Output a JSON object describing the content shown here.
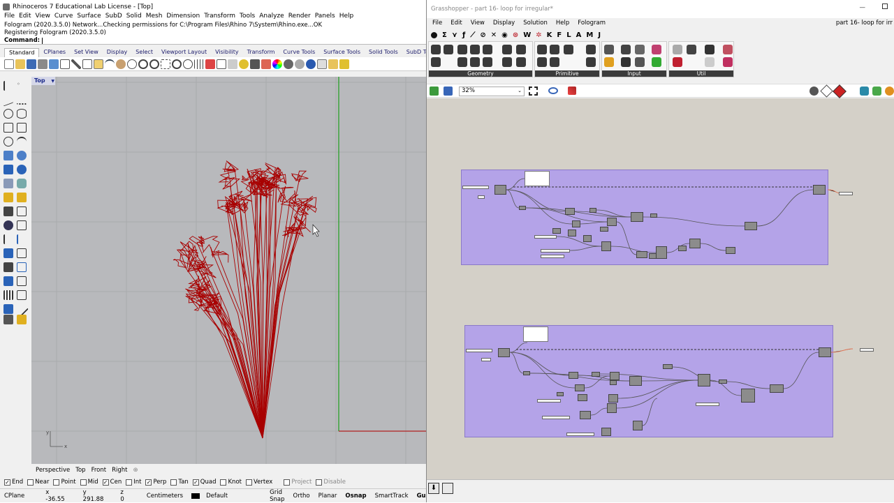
{
  "rhino": {
    "title": "Rhinoceros 7 Educational Lab License - [Top]",
    "menu": [
      "File",
      "Edit",
      "View",
      "Curve",
      "Surface",
      "SubD",
      "Solid",
      "Mesh",
      "Dimension",
      "Transform",
      "Tools",
      "Analyze",
      "Render",
      "Panels",
      "Help"
    ],
    "command_history": [
      "Fologram (2020.3.5.0) Network...Checking permissions for C:\\Program Files\\Rhino 7\\System\\Rhino.exe...OK",
      "Registering Fologram (2020.3.5.0)"
    ],
    "command_label": "Command:",
    "toolbar_tabs": [
      "Standard",
      "CPlanes",
      "Set View",
      "Display",
      "Select",
      "Viewport Layout",
      "Visibility",
      "Transform",
      "Curve Tools",
      "Surface Tools",
      "Solid Tools",
      "SubD Tools"
    ],
    "active_tab": "Standard",
    "viewport_label": "Top",
    "axis_x": "x",
    "axis_y": "y",
    "viewport_tabs": [
      "Perspective",
      "Top",
      "Front",
      "Right"
    ],
    "osnaps": [
      {
        "label": "End",
        "checked": true
      },
      {
        "label": "Near",
        "checked": false
      },
      {
        "label": "Point",
        "checked": false
      },
      {
        "label": "Mid",
        "checked": false
      },
      {
        "label": "Cen",
        "checked": true
      },
      {
        "label": "Int",
        "checked": false
      },
      {
        "label": "Perp",
        "checked": true
      },
      {
        "label": "Tan",
        "checked": false
      },
      {
        "label": "Quad",
        "checked": true
      },
      {
        "label": "Knot",
        "checked": false
      },
      {
        "label": "Vertex",
        "checked": false
      },
      {
        "label": "Project",
        "checked": false
      },
      {
        "label": "Disable",
        "checked": false
      }
    ],
    "status": {
      "cplane": "CPlane",
      "x": "x -36.55",
      "y": "y 291.88",
      "z": "z 0",
      "units": "Centimeters",
      "layer": "Default",
      "grid_snap": "Grid Snap",
      "ortho": "Ortho",
      "planar": "Planar",
      "osnap": "Osnap",
      "smarttrack": "SmartTrack",
      "gumball": "Gumb"
    },
    "colors": {
      "viewport_bg": "#b8b9bc",
      "geometry": "#a80000",
      "grid_y_axis": "#1c9e1c",
      "grid_x_axis": "#b02020"
    }
  },
  "grasshopper": {
    "title": "Grasshopper - part 16- loop for irregular*",
    "title_right": "part 16- loop for irr",
    "menu": [
      "File",
      "Edit",
      "View",
      "Display",
      "Solution",
      "Help",
      "Fologram"
    ],
    "tab_icons": [
      "Σ",
      "⋎",
      "ƒ",
      "⟋",
      "⊘",
      "✕",
      "◉",
      "⊛",
      "W",
      "✲",
      "K",
      "F",
      "L",
      "A",
      "M",
      "J"
    ],
    "ribbon_groups": [
      "Geometry",
      "Primitive",
      "Input",
      "Util"
    ],
    "zoom": "32%",
    "colors": {
      "canvas": "#d4d0c8",
      "group": "#b4a3e8",
      "component": "#8c8c8c"
    }
  }
}
